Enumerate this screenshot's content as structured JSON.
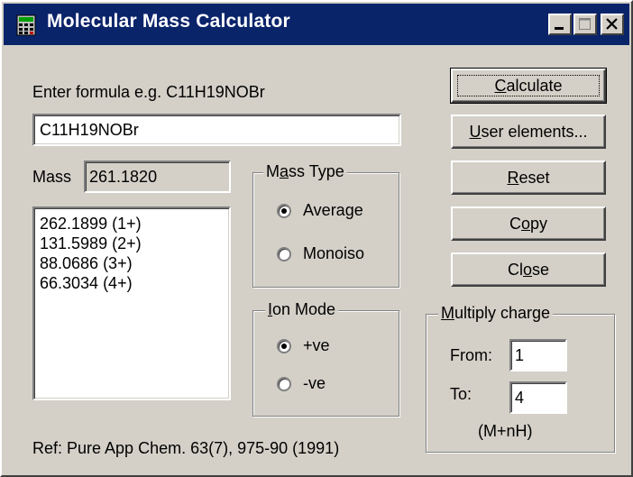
{
  "window": {
    "title": "Molecular Mass Calculator",
    "minimize_icon": "minimize-icon",
    "maximize_icon": "maximize-icon",
    "close_icon": "close-icon",
    "app_icon": "calculator-icon"
  },
  "formula": {
    "prompt": "Enter formula e.g. C11H19NOBr",
    "value": "C11H19NOBr"
  },
  "mass": {
    "label": "Mass",
    "value": "261.1820"
  },
  "results": [
    "262.1899 (1+)",
    "131.5989 (2+)",
    "88.0686 (3+)",
    "66.3034 (4+)"
  ],
  "mass_type": {
    "title_pre": "M",
    "title_u": "a",
    "title_post": "ss Type",
    "options": [
      {
        "label": "Average",
        "checked": true
      },
      {
        "label": "Monoiso",
        "checked": false
      }
    ]
  },
  "ion_mode": {
    "title_u": "I",
    "title_post": "on Mode",
    "options": [
      {
        "label": "+ve",
        "checked": true
      },
      {
        "label": "-ve",
        "checked": false
      }
    ]
  },
  "buttons": {
    "calculate_u": "C",
    "calculate_rest": "alculate",
    "user_u": "U",
    "user_rest": "ser elements...",
    "reset_u": "R",
    "reset_rest": "eset",
    "copy_pre": "C",
    "copy_u": "o",
    "copy_post": "py",
    "close_pre": "Cl",
    "close_u": "o",
    "close_post": "se"
  },
  "multiply": {
    "title_u": "M",
    "title_post": "ultiply charge",
    "from_label": "From:",
    "from_value": "1",
    "to_label": "To:",
    "to_value": "4",
    "note": "(M+nH)"
  },
  "reference": "Ref: Pure App Chem. 63(7), 975-90 (1991)",
  "colors": {
    "titlebar": "#0a246a",
    "face": "#d4d0c8"
  }
}
